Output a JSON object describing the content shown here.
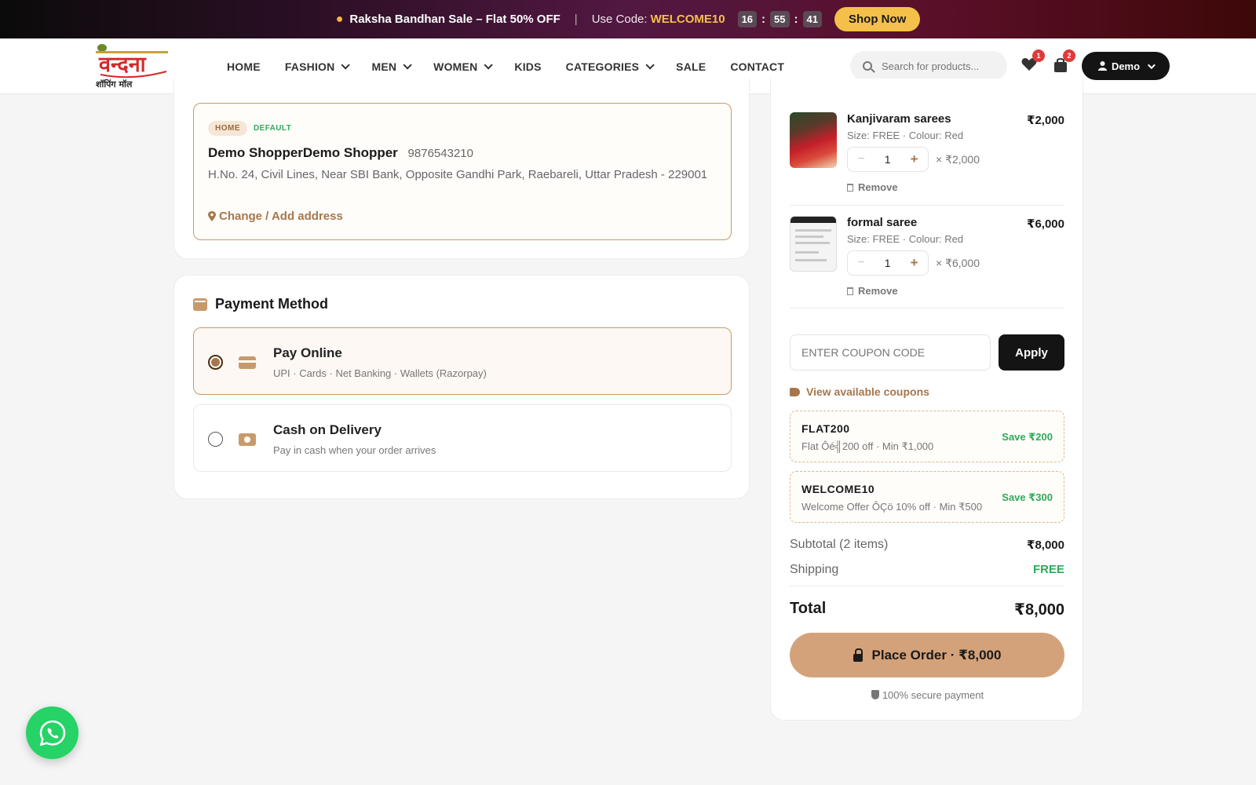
{
  "promo": {
    "sale_text": "Raksha Bandhan Sale – Flat 50% OFF",
    "separator": "|",
    "code_label": "Use Code:",
    "code": "WELCOME10",
    "timer": [
      "16",
      "55",
      "41"
    ],
    "shop_label": "Shop Now"
  },
  "header": {
    "nav": [
      {
        "label": "HOME",
        "dropdown": false
      },
      {
        "label": "FASHION",
        "dropdown": true
      },
      {
        "label": "MEN",
        "dropdown": true
      },
      {
        "label": "WOMEN",
        "dropdown": true
      },
      {
        "label": "KIDS",
        "dropdown": false
      },
      {
        "label": "CATEGORIES",
        "dropdown": true
      },
      {
        "label": "SALE",
        "dropdown": false
      },
      {
        "label": "CONTACT",
        "dropdown": false
      }
    ],
    "search_placeholder": "Search for products...",
    "wishlist_count": "1",
    "cart_count": "2",
    "user_label": "Demo"
  },
  "address": {
    "tag": "HOME",
    "default_label": "DEFAULT",
    "name": "Demo ShopperDemo Shopper",
    "phone": "9876543210",
    "text": "H.No. 24, Civil Lines, Near SBI Bank, Opposite Gandhi Park, Raebareli, Uttar Pradesh - 229001",
    "change_label": "Change / Add address"
  },
  "payment": {
    "title": "Payment Method",
    "options": [
      {
        "title": "Pay Online",
        "sub": "UPI · Cards · Net Banking · Wallets (Razorpay)",
        "selected": true
      },
      {
        "title": "Cash on Delivery",
        "sub": "Pay in cash when your order arrives",
        "selected": false
      }
    ]
  },
  "cart": {
    "items": [
      {
        "name": "Kanjivaram sarees",
        "price": "₹2,000",
        "meta": "Size: FREE · Colour: Red",
        "qty": "1",
        "qty_total": "× ₹2,000",
        "minus": "−",
        "plus": "+",
        "remove": "Remove"
      },
      {
        "name": "formal saree",
        "price": "₹6,000",
        "meta": "Size: FREE · Colour: Red",
        "qty": "1",
        "qty_total": "× ₹6,000",
        "minus": "−",
        "plus": "+",
        "remove": "Remove"
      }
    ],
    "coupon_placeholder": "ENTER COUPON CODE",
    "apply_label": "Apply",
    "view_coupons": "View available coupons",
    "coupons": [
      {
        "code": "FLAT200",
        "desc": "Flat Ôé╣200 off · Min ₹1,000",
        "save": "Save ₹200"
      },
      {
        "code": "WELCOME10",
        "desc": "Welcome Offer ÔÇö 10% off · Min ₹500",
        "save": "Save ₹300"
      }
    ],
    "subtotal_label": "Subtotal (2 items)",
    "subtotal_value": "₹8,000",
    "shipping_label": "Shipping",
    "shipping_value": "FREE",
    "total_label": "Total",
    "total_value": "₹8,000",
    "place_order": "Place Order · ₹8,000",
    "secure": "100% secure payment"
  },
  "logo": {
    "main": "वन्दना",
    "tagline": "शॉपिंग मॉल"
  },
  "colors": {
    "accent": "#c89a6a",
    "accent_dark": "#a8764a",
    "success": "#2eaa5a",
    "button_dark": "#141414",
    "place_order": "#d4a27a",
    "whatsapp": "#25d366"
  }
}
